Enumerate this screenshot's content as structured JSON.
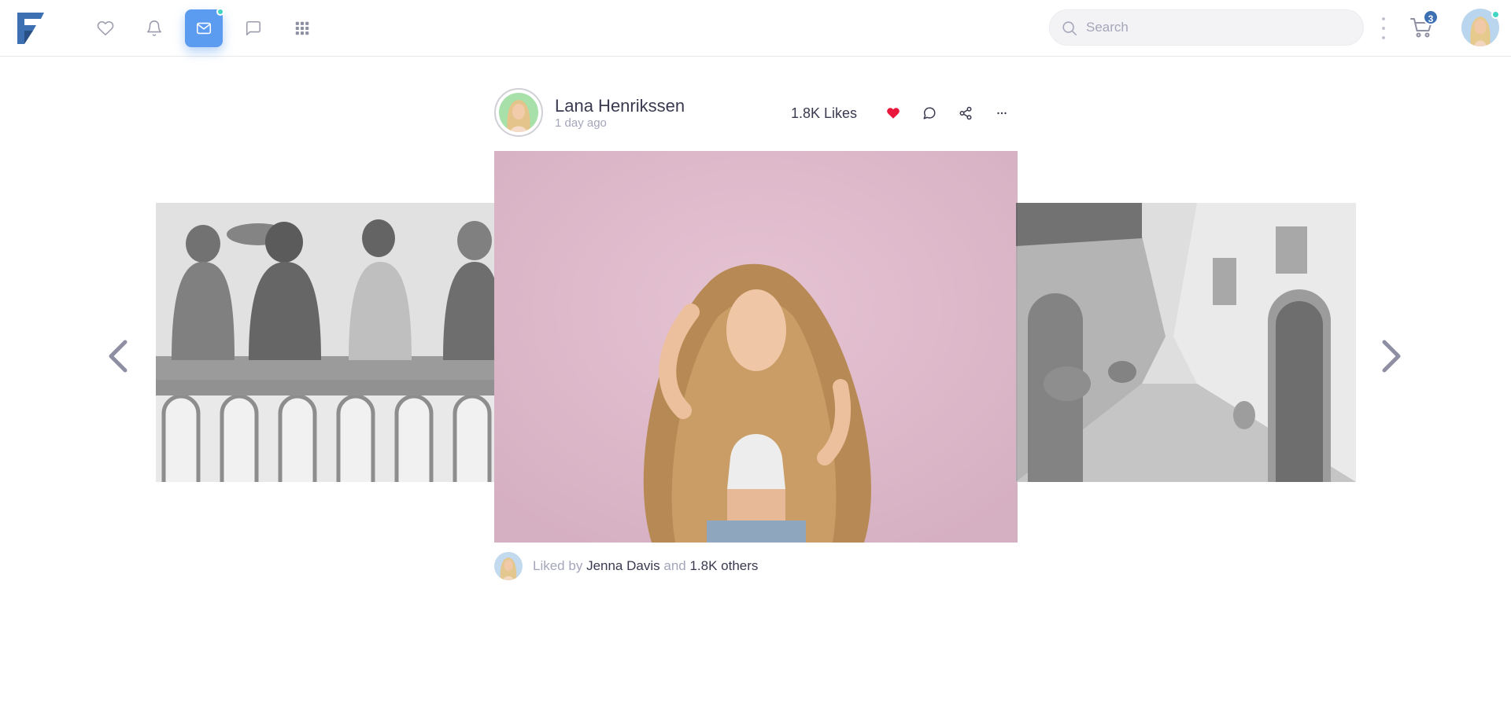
{
  "navbar": {
    "search_placeholder": "Search",
    "cart_badge": "3",
    "icons": [
      "heart-icon",
      "bell-icon",
      "mail-icon",
      "chat-icon",
      "apps-grid-icon"
    ]
  },
  "post": {
    "author_name": "Lana Henrikssen",
    "time": "1 day ago",
    "likes": "1.8K Likes",
    "liked_by_prefix": "Liked by",
    "liked_by_name": "Jenna Davis",
    "liked_by_and": "and",
    "liked_by_others": "1.8K others"
  },
  "colors": {
    "accent": "#5b9bf0",
    "online_dot": "#41d6c3",
    "like_heart": "#e8173b",
    "badge": "#3d70b2"
  }
}
